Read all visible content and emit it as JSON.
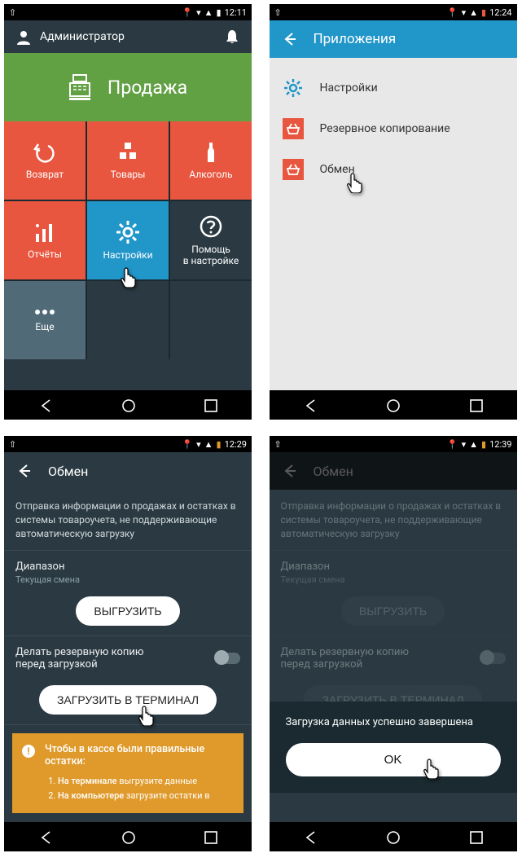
{
  "status": {
    "time1": "12:11",
    "time2": "12:24",
    "time3": "12:29",
    "time4": "12:39"
  },
  "p1": {
    "user": "Администратор",
    "sale": "Продажа",
    "tiles": {
      "return": "Возврат",
      "goods": "Товары",
      "alcohol": "Алкоголь",
      "reports": "Отчёты",
      "settings": "Настройки",
      "help_l1": "Помощь",
      "help_l2": "в настройке",
      "more": "Еще"
    }
  },
  "p2": {
    "title": "Приложения",
    "items": {
      "settings": "Настройки",
      "backup": "Резервное копирование",
      "exchange": "Обмен"
    }
  },
  "p3": {
    "title": "Обмен",
    "desc": "Отправка информации о продажах и остатках в системы товароучета, не поддерживающие автоматическую загрузку",
    "range_label": "Диапазон",
    "range_value": "Текущая смена",
    "unload_btn": "ВЫГРУЗИТЬ",
    "backup_label": "Делать резервную копию перед загрузкой",
    "load_btn": "ЗАГРУЗИТЬ В ТЕРМИНАЛ",
    "banner_title": "Чтобы в кассе были правильные остатки:",
    "banner_step1_a": "На терминале",
    "banner_step1_b": " выгрузите данные",
    "banner_step2_a": "На компьютере",
    "banner_step2_b": " загрузите остатки в"
  },
  "p4": {
    "toast_msg": "Загрузка данных успешно завершена",
    "ok": "OK"
  }
}
